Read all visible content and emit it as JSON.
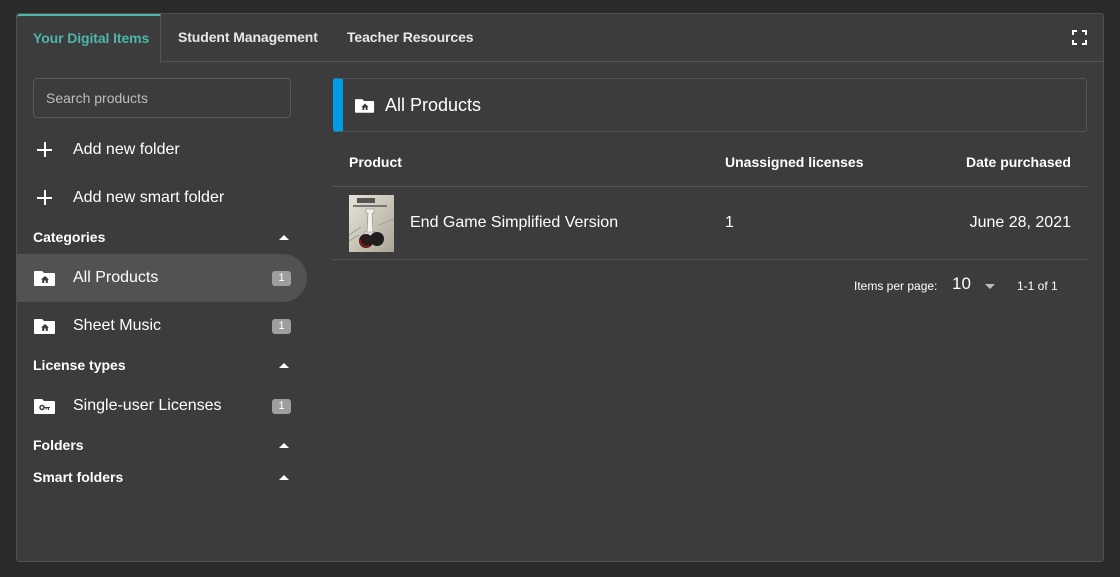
{
  "tabs": [
    {
      "label": "Your Digital Items",
      "active": true
    },
    {
      "label": "Student Management",
      "active": false
    },
    {
      "label": "Teacher Resources",
      "active": false
    }
  ],
  "toolbar": {
    "fullscreen_icon": "fullscreen-icon"
  },
  "sidebar": {
    "search_placeholder": "Search products",
    "search_value": "",
    "actions": [
      {
        "label": "Add new folder",
        "icon": "plus-icon"
      },
      {
        "label": "Add new smart folder",
        "icon": "plus-icon"
      }
    ],
    "sections": {
      "categories": {
        "title": "Categories",
        "items": [
          {
            "label": "All Products",
            "count": "1",
            "icon": "folder-home-icon",
            "selected": true
          },
          {
            "label": "Sheet Music",
            "count": "1",
            "icon": "folder-home-icon",
            "selected": false
          }
        ]
      },
      "license_types": {
        "title": "License types",
        "items": [
          {
            "label": "Single-user Licenses",
            "count": "1",
            "icon": "folder-key-icon",
            "selected": false
          }
        ]
      },
      "folders": {
        "title": "Folders"
      },
      "smart_folders": {
        "title": "Smart folders"
      }
    }
  },
  "main": {
    "header_title": "All Products",
    "accent_color": "#039be5",
    "table": {
      "columns": [
        "Product",
        "Unassigned licenses",
        "Date purchased"
      ],
      "rows": [
        {
          "product": "End Game Simplified Version",
          "unassigned_licenses": "1",
          "date_purchased": "June 28, 2021",
          "thumbnail": "chess-cover-thumbnail"
        }
      ]
    },
    "pagination": {
      "items_per_page_label": "Items per page:",
      "items_per_page": "10",
      "range": "1-1 of 1"
    }
  },
  "colors": {
    "active_tab": "#4db6ac",
    "background": "#3c3c3c",
    "badge": "#9e9e9e"
  }
}
